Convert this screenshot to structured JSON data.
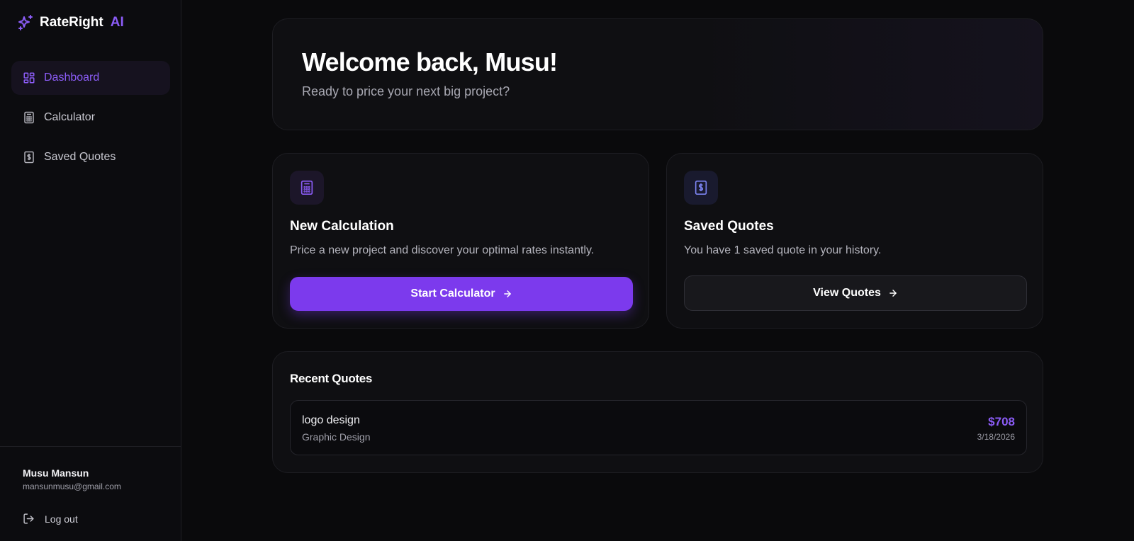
{
  "brand": {
    "name": "RateRight",
    "suffix": "AI"
  },
  "nav": {
    "items": [
      {
        "label": "Dashboard",
        "icon": "dashboard-grid-icon",
        "active": true
      },
      {
        "label": "Calculator",
        "icon": "calculator-icon",
        "active": false
      },
      {
        "label": "Saved Quotes",
        "icon": "receipt-dollar-icon",
        "active": false
      }
    ]
  },
  "user": {
    "name": "Musu Mansun",
    "email": "mansunmusu@gmail.com",
    "logout_label": "Log out"
  },
  "hero": {
    "title": "Welcome back, Musu!",
    "subtitle": "Ready to price your next big project?"
  },
  "actions": {
    "new_calc": {
      "title": "New Calculation",
      "description": "Price a new project and discover your optimal rates instantly.",
      "button": "Start Calculator"
    },
    "saved": {
      "title": "Saved Quotes",
      "description": "You have 1 saved quote in your history.",
      "button": "View Quotes"
    }
  },
  "recent": {
    "title": "Recent Quotes",
    "items": [
      {
        "name": "logo design",
        "category": "Graphic Design",
        "price": "$708",
        "date": "3/18/2026"
      }
    ]
  },
  "colors": {
    "accent": "#7c3aed",
    "accent_text": "#8b5cf6",
    "background": "#0a0a0c"
  }
}
